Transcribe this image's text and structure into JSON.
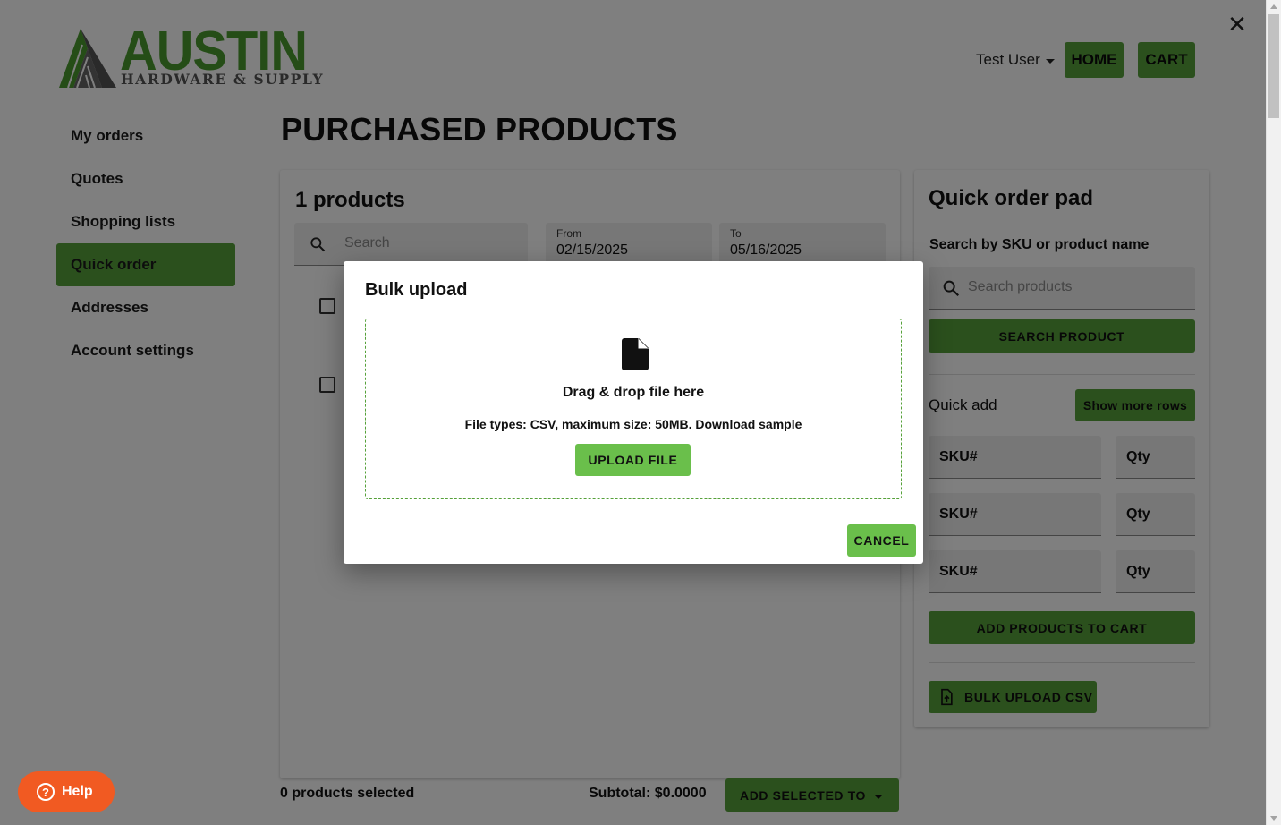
{
  "header": {
    "logo_main": "AUSTIN",
    "logo_sub": "HARDWARE & SUPPLY",
    "user_name": "Test User",
    "home_label": "HOME",
    "cart_label": "CART",
    "close_glyph": "✕"
  },
  "sidebar": {
    "items": [
      {
        "label": "My orders"
      },
      {
        "label": "Quotes"
      },
      {
        "label": "Shopping lists"
      },
      {
        "label": "Quick order"
      },
      {
        "label": "Addresses"
      },
      {
        "label": "Account settings"
      }
    ],
    "active_index": 3
  },
  "main": {
    "page_title": "PURCHASED PRODUCTS",
    "products_count": "1 products",
    "search_placeholder": "Search",
    "from_label": "From",
    "from_value": "02/15/2025",
    "to_label": "To",
    "to_value": "05/16/2025"
  },
  "quick_order": {
    "title": "Quick order pad",
    "search_label": "Search by SKU or product name",
    "search_placeholder": "Search products",
    "search_button": "SEARCH PRODUCT",
    "quick_add_label": "Quick add",
    "show_more_rows": "Show more rows",
    "rows": [
      {
        "sku": "SKU#",
        "qty": "Qty"
      },
      {
        "sku": "SKU#",
        "qty": "Qty"
      },
      {
        "sku": "SKU#",
        "qty": "Qty"
      }
    ],
    "add_to_cart_button": "ADD PRODUCTS TO CART",
    "bulk_upload_button": "BULK UPLOAD CSV"
  },
  "footer": {
    "selected_count": "0 products selected",
    "subtotal": "Subtotal: $0.0000",
    "add_selected": "ADD SELECTED TO",
    "help_label": "Help"
  },
  "modal": {
    "title": "Bulk upload",
    "drop_heading": "Drag & drop file here",
    "file_info": "File types: CSV, maximum size: 50MB. ",
    "download_sample": "Download sample",
    "upload_button": "UPLOAD FILE",
    "cancel_button": "CANCEL"
  },
  "colors": {
    "brand_green": "#56a13a",
    "modal_green": "#6abf4b",
    "help_orange": "#f15a22",
    "overlay": "rgba(0,0,0,0.5)"
  }
}
